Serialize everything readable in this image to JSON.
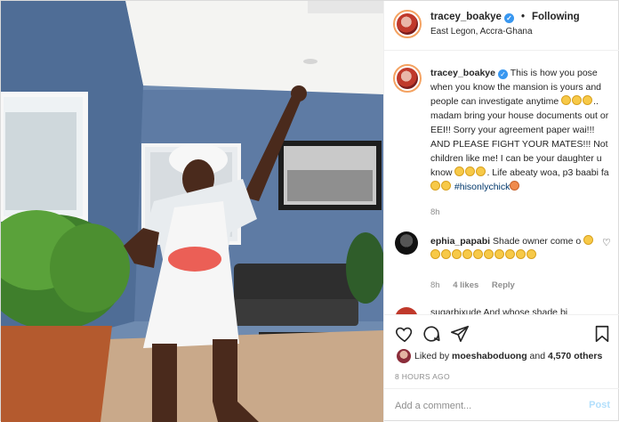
{
  "header": {
    "username": "tracey_boakye",
    "separator": "•",
    "follow_state": "Following",
    "location": "East Legon, Accra-Ghana"
  },
  "caption": {
    "username": "tracey_boakye",
    "text_1": "This is how you pose when you know the mansion is yours and people can investigate anytime",
    "text_2": ".. madam bring your house documents out or EEI!! Sorry your agreement paper wai!!! AND PLEASE FIGHT YOUR MATES!!! Not children like me! I can be your daughter u know",
    "text_3": ". Life abeaty woa, p3 baabi fa",
    "hashtag": "#hisonlychick",
    "time": "8h"
  },
  "comment_1": {
    "username": "ephia_papabi",
    "text": "Shade owner come o",
    "time": "8h",
    "likes": "4 likes",
    "reply": "Reply"
  },
  "comment_2": {
    "preview": "sugarbixude  And whose shade bi"
  },
  "actions": {
    "liked_by_prefix": "Liked by",
    "liked_by_user": "moeshaboduong",
    "liked_by_and": "and",
    "liked_by_count": "4,570 others",
    "time_ago": "8 HOURS AGO"
  },
  "add_comment": {
    "placeholder": "Add a comment...",
    "post_label": "Post"
  },
  "colors": {
    "verified": "#3897f0",
    "hashtag": "#00376b",
    "post_disabled": "#b2dffc"
  },
  "icons": [
    "heart-icon",
    "comment-icon",
    "share-icon",
    "bookmark-icon",
    "verified-icon"
  ]
}
